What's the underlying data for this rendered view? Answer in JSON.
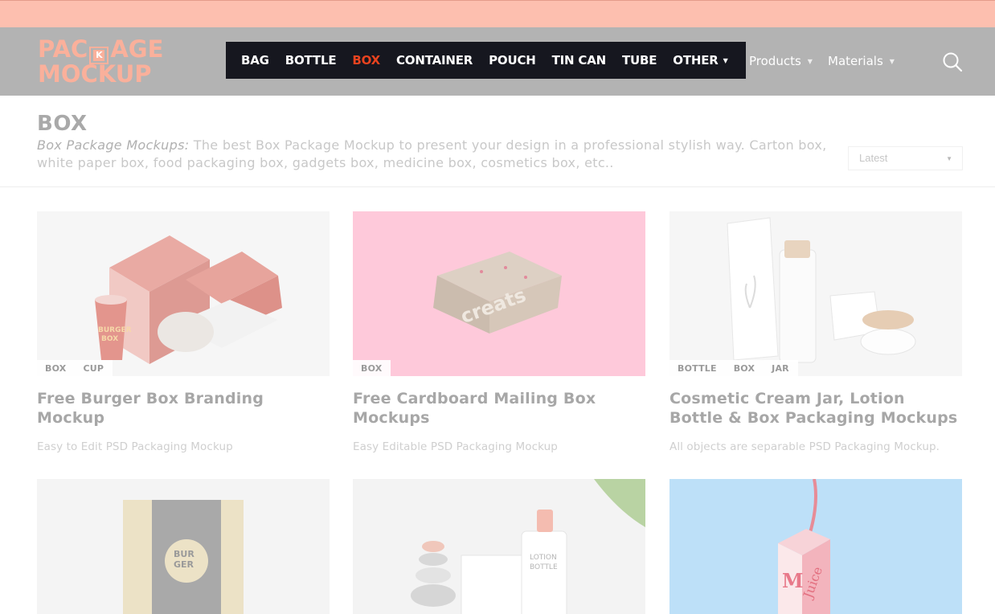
{
  "logo": {
    "line1_a": "PAC",
    "line1_k": "K",
    "line1_b": "AGE",
    "line2": "MOCKUP"
  },
  "nav": {
    "items": [
      {
        "label": "BAG",
        "active": false
      },
      {
        "label": "BOTTLE",
        "active": false
      },
      {
        "label": "BOX",
        "active": true
      },
      {
        "label": "CONTAINER",
        "active": false
      },
      {
        "label": "POUCH",
        "active": false
      },
      {
        "label": "TIN CAN",
        "active": false
      },
      {
        "label": "TUBE",
        "active": false
      },
      {
        "label": "OTHER",
        "active": false
      }
    ],
    "products_label": "Products",
    "materials_label": "Materials",
    "caret_icon": "chevron-down-icon",
    "search_icon": "search-icon"
  },
  "page": {
    "title": "BOX",
    "desc_em": "Box Package Mockups:",
    "desc_text": " The best Box Package Mockup to present your design in a professional stylish way. Carton box, white paper box, food packaging box, gadgets box, medicine box, cosmetics box, etc..",
    "sort_selected": "Latest"
  },
  "cards": [
    {
      "tags": [
        "BOX",
        "CUP"
      ],
      "title": "Free Burger Box Branding Mockup",
      "subtitle": "Easy to Edit PSD Packaging Mockup"
    },
    {
      "tags": [
        "BOX"
      ],
      "title": "Free Cardboard Mailing Box Mockups",
      "subtitle": "Easy Editable PSD Packaging Mockup"
    },
    {
      "tags": [
        "BOTTLE",
        "BOX",
        "JAR"
      ],
      "title": "Cosmetic Cream Jar, Lotion Bottle & Box Packaging Mockups",
      "subtitle": "All objects are separable PSD Packaging Mockup."
    }
  ],
  "colors": {
    "topbar": "#fdbfaf",
    "header": "#b3b3b3",
    "nav_bg": "#16171f",
    "nav_active": "#e8431f",
    "logo": "#fab09b"
  }
}
